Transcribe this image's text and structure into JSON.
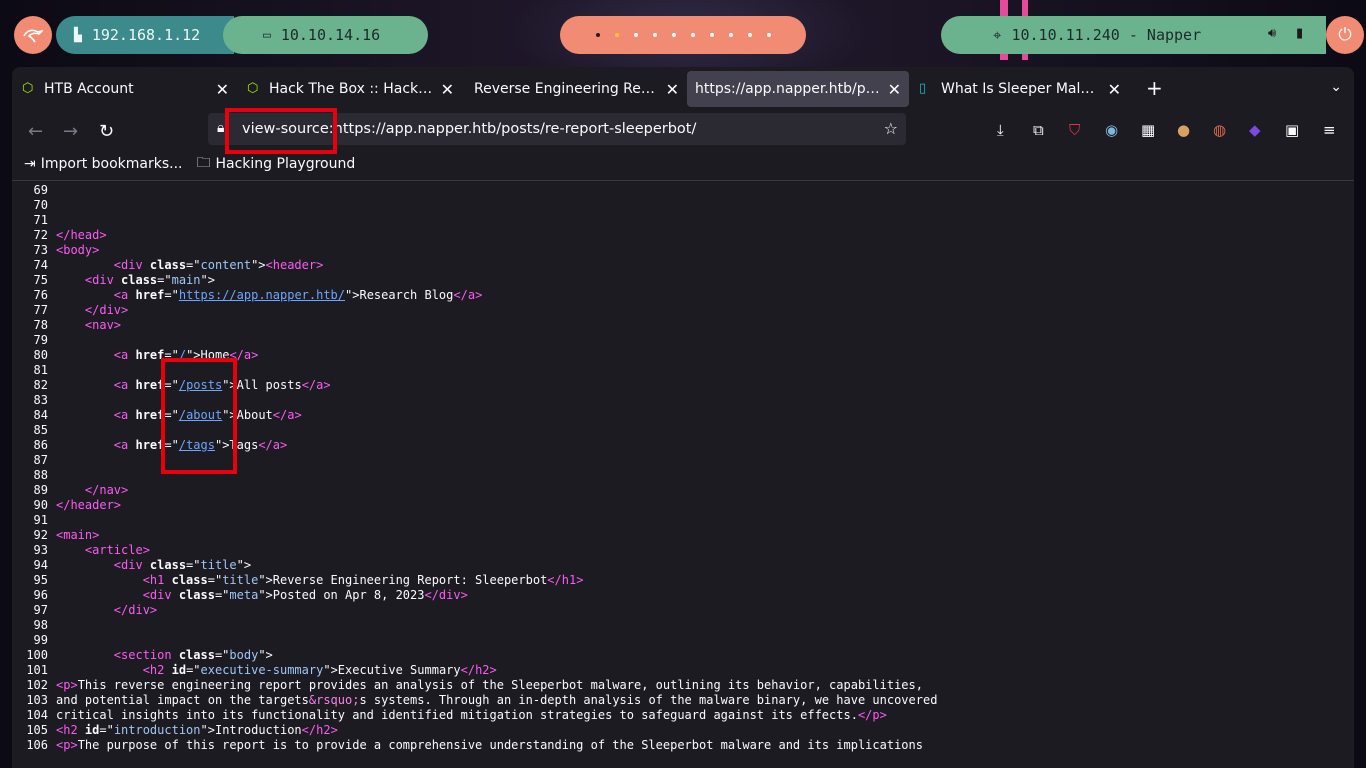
{
  "topbar": {
    "local_ip": "192.168.1.12",
    "vpn_ip": "10.10.14.16",
    "target": "10.10.11.240 - Napper",
    "colors": {
      "salmon": "#f28b74",
      "teal_dark": "#3d8a8d",
      "green": "#6bb38e"
    }
  },
  "tabs": [
    {
      "label": "HTB Account",
      "icon": "cube-icon"
    },
    {
      "label": "Hack The Box :: Hack The Box",
      "icon": "cube-icon"
    },
    {
      "label": "Reverse Engineering Report: Sleeperbot",
      "icon": ""
    },
    {
      "label": "https://app.napper.htb/posts/re-report-sleeperbot/",
      "icon": "",
      "active": true
    },
    {
      "label": "What Is Sleeper Malware",
      "icon": "teal-page-icon"
    }
  ],
  "url": "view-source:https://app.napper.htb/posts/re-report-sleeperbot/",
  "bookmarks": [
    {
      "label": "Import bookmarks..."
    },
    {
      "label": "Hacking Playground"
    }
  ],
  "source_lines": [
    {
      "n": "69",
      "c": []
    },
    {
      "n": "70",
      "c": []
    },
    {
      "n": "71",
      "c": []
    },
    {
      "n": "72",
      "c": [
        [
          "tag",
          "</head>"
        ]
      ]
    },
    {
      "n": "73",
      "c": [
        [
          "tag",
          "<body>"
        ]
      ]
    },
    {
      "n": "74",
      "c": [
        [
          "t",
          "        "
        ],
        [
          "tag",
          "<div "
        ],
        [
          "an",
          "class"
        ],
        [
          "t",
          "=\""
        ],
        [
          "av",
          "content"
        ],
        [
          "t",
          "\">"
        ],
        [
          "tag",
          "<header>"
        ]
      ]
    },
    {
      "n": "75",
      "c": [
        [
          "t",
          "    "
        ],
        [
          "tag",
          "<div "
        ],
        [
          "an",
          "class"
        ],
        [
          "t",
          "=\""
        ],
        [
          "av",
          "main"
        ],
        [
          "t",
          "\">"
        ]
      ]
    },
    {
      "n": "76",
      "c": [
        [
          "t",
          "        "
        ],
        [
          "tag",
          "<a "
        ],
        [
          "an",
          "href"
        ],
        [
          "t",
          "=\""
        ],
        [
          "lk",
          "https://app.napper.htb/"
        ],
        [
          "t",
          "\">Research Blog"
        ],
        [
          "tag",
          "</a>"
        ]
      ]
    },
    {
      "n": "77",
      "c": [
        [
          "t",
          "    "
        ],
        [
          "tag",
          "</div>"
        ]
      ]
    },
    {
      "n": "78",
      "c": [
        [
          "t",
          "    "
        ],
        [
          "tag",
          "<nav>"
        ]
      ]
    },
    {
      "n": "79",
      "c": []
    },
    {
      "n": "80",
      "c": [
        [
          "t",
          "        "
        ],
        [
          "tag",
          "<a "
        ],
        [
          "an",
          "href"
        ],
        [
          "t",
          "=\""
        ],
        [
          "lk",
          "/"
        ],
        [
          "t",
          "\">Home"
        ],
        [
          "tag",
          "</a>"
        ]
      ]
    },
    {
      "n": "81",
      "c": []
    },
    {
      "n": "82",
      "c": [
        [
          "t",
          "        "
        ],
        [
          "tag",
          "<a "
        ],
        [
          "an",
          "href"
        ],
        [
          "t",
          "=\""
        ],
        [
          "lk",
          "/posts"
        ],
        [
          "t",
          "\">All posts"
        ],
        [
          "tag",
          "</a>"
        ]
      ]
    },
    {
      "n": "83",
      "c": []
    },
    {
      "n": "84",
      "c": [
        [
          "t",
          "        "
        ],
        [
          "tag",
          "<a "
        ],
        [
          "an",
          "href"
        ],
        [
          "t",
          "=\""
        ],
        [
          "lk",
          "/about"
        ],
        [
          "t",
          "\">About"
        ],
        [
          "tag",
          "</a>"
        ]
      ]
    },
    {
      "n": "85",
      "c": []
    },
    {
      "n": "86",
      "c": [
        [
          "t",
          "        "
        ],
        [
          "tag",
          "<a "
        ],
        [
          "an",
          "href"
        ],
        [
          "t",
          "=\""
        ],
        [
          "lk",
          "/tags"
        ],
        [
          "t",
          "\">Tags"
        ],
        [
          "tag",
          "</a>"
        ]
      ]
    },
    {
      "n": "87",
      "c": []
    },
    {
      "n": "88",
      "c": []
    },
    {
      "n": "89",
      "c": [
        [
          "t",
          "    "
        ],
        [
          "tag",
          "</nav>"
        ]
      ]
    },
    {
      "n": "90",
      "c": [
        [
          "tag",
          "</header>"
        ]
      ]
    },
    {
      "n": "91",
      "c": []
    },
    {
      "n": "92",
      "c": [
        [
          "tag",
          "<main>"
        ]
      ]
    },
    {
      "n": "93",
      "c": [
        [
          "t",
          "    "
        ],
        [
          "tag",
          "<article>"
        ]
      ]
    },
    {
      "n": "94",
      "c": [
        [
          "t",
          "        "
        ],
        [
          "tag",
          "<div "
        ],
        [
          "an",
          "class"
        ],
        [
          "t",
          "=\""
        ],
        [
          "av",
          "title"
        ],
        [
          "t",
          "\">"
        ]
      ]
    },
    {
      "n": "95",
      "c": [
        [
          "t",
          "            "
        ],
        [
          "tag",
          "<h1 "
        ],
        [
          "an",
          "class"
        ],
        [
          "t",
          "=\""
        ],
        [
          "av",
          "title"
        ],
        [
          "t",
          "\">Reverse Engineering Report: Sleeperbot"
        ],
        [
          "tag",
          "</h1>"
        ]
      ]
    },
    {
      "n": "96",
      "c": [
        [
          "t",
          "            "
        ],
        [
          "tag",
          "<div "
        ],
        [
          "an",
          "class"
        ],
        [
          "t",
          "=\""
        ],
        [
          "av",
          "meta"
        ],
        [
          "t",
          "\">Posted on Apr 8, 2023"
        ],
        [
          "tag",
          "</div>"
        ]
      ]
    },
    {
      "n": "97",
      "c": [
        [
          "t",
          "        "
        ],
        [
          "tag",
          "</div>"
        ]
      ]
    },
    {
      "n": "98",
      "c": []
    },
    {
      "n": "99",
      "c": []
    },
    {
      "n": "100",
      "c": [
        [
          "t",
          "        "
        ],
        [
          "tag",
          "<section "
        ],
        [
          "an",
          "class"
        ],
        [
          "t",
          "=\""
        ],
        [
          "av",
          "body"
        ],
        [
          "t",
          "\">"
        ]
      ]
    },
    {
      "n": "101",
      "c": [
        [
          "t",
          "            "
        ],
        [
          "tag",
          "<h2 "
        ],
        [
          "an",
          "id"
        ],
        [
          "t",
          "=\""
        ],
        [
          "av",
          "executive-summary"
        ],
        [
          "t",
          "\">Executive Summary"
        ],
        [
          "tag",
          "</h2>"
        ]
      ]
    },
    {
      "n": "102",
      "c": [
        [
          "tag",
          "<p>"
        ],
        [
          "t",
          "This reverse engineering report provides an analysis of the Sleeperbot malware, outlining its behavior, capabilities,"
        ]
      ]
    },
    {
      "n": "103",
      "c": [
        [
          "t",
          "and potential impact on the targets"
        ],
        [
          "ent",
          "&rsquo;"
        ],
        [
          "t",
          "s systems. Through an in-depth analysis of the malware binary, we have uncovered"
        ]
      ]
    },
    {
      "n": "104",
      "c": [
        [
          "t",
          "critical insights into its functionality and identified mitigation strategies to safeguard against its effects."
        ],
        [
          "tag",
          "</p>"
        ]
      ]
    },
    {
      "n": "105",
      "c": [
        [
          "tag",
          "<h2 "
        ],
        [
          "an",
          "id"
        ],
        [
          "t",
          "=\""
        ],
        [
          "av",
          "introduction"
        ],
        [
          "t",
          "\">Introduction"
        ],
        [
          "tag",
          "</h2>"
        ]
      ]
    },
    {
      "n": "106",
      "c": [
        [
          "tag",
          "<p>"
        ],
        [
          "t",
          "The purpose of this report is to provide a comprehensive understanding of the Sleeperbot malware and its implications"
        ]
      ]
    }
  ]
}
